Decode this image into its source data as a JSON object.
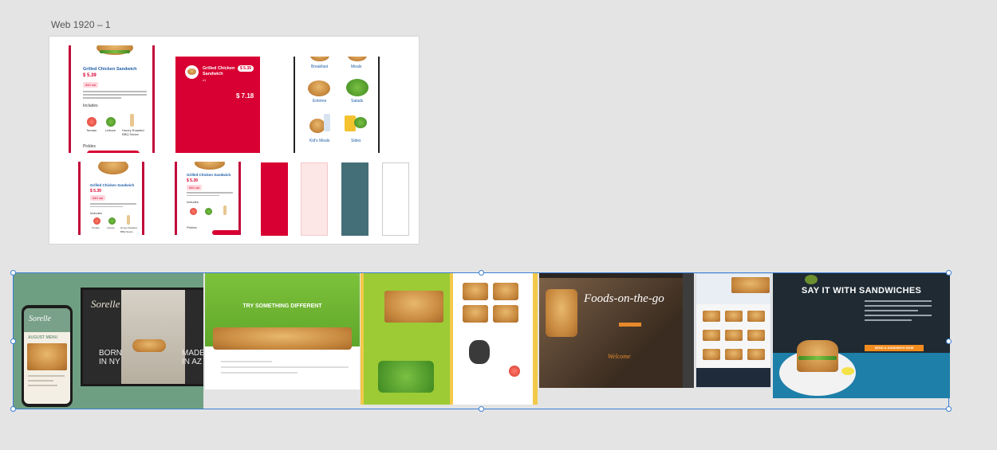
{
  "artboard": {
    "label": "Web 1920 – 1"
  },
  "phones": {
    "p1": {
      "title": "Grilled Chicken Sandwich",
      "price": "$ 5.39",
      "tag": "540 cal",
      "section": "Includes",
      "items": [
        "Tomato",
        "Lettuce",
        "Honey Roasted BBQ Sauce"
      ],
      "footer": "Pickles"
    },
    "p2": {
      "title": "Grilled Chicken Sandwich",
      "qty": "x1",
      "badge": "$ 5.39",
      "total": "$ 7.18"
    },
    "p3": {
      "categories": [
        "Breakfast",
        "Meals",
        "Entrées",
        "Salads",
        "Kid's Meals",
        "Sides"
      ]
    },
    "p4": {
      "title": "Grilled Chicken Sandwich",
      "price": "$ 5.39",
      "tag": "540 cal",
      "section": "Includes",
      "items": [
        "Tomato",
        "Lettuce",
        "Honey Roasted BBQ Sauce"
      ]
    },
    "p5": {
      "title": "Grilled Chicken Sandwich",
      "price": "$ 5.39",
      "tag": "540 cal",
      "section": "Includes",
      "footer": "Pickles"
    }
  },
  "swatches": [
    "#d80032",
    "#fde6e6",
    "#456f78",
    "#ffffff"
  ],
  "moodboard": {
    "t1": {
      "logo": "Sorelle",
      "left": "BORN IN NY",
      "right": "MADE IN AZ",
      "menu": "AUGUST MENU"
    },
    "t2": {
      "headline": "TRY SOMETHING DIFFERENT"
    },
    "t4": {
      "script": "Foods-on-the-go",
      "sub": "Welcome"
    },
    "t6": {
      "headline": "SAY IT WITH SANDWICHES",
      "cta": "SEND A SANDWICH NOW"
    }
  }
}
